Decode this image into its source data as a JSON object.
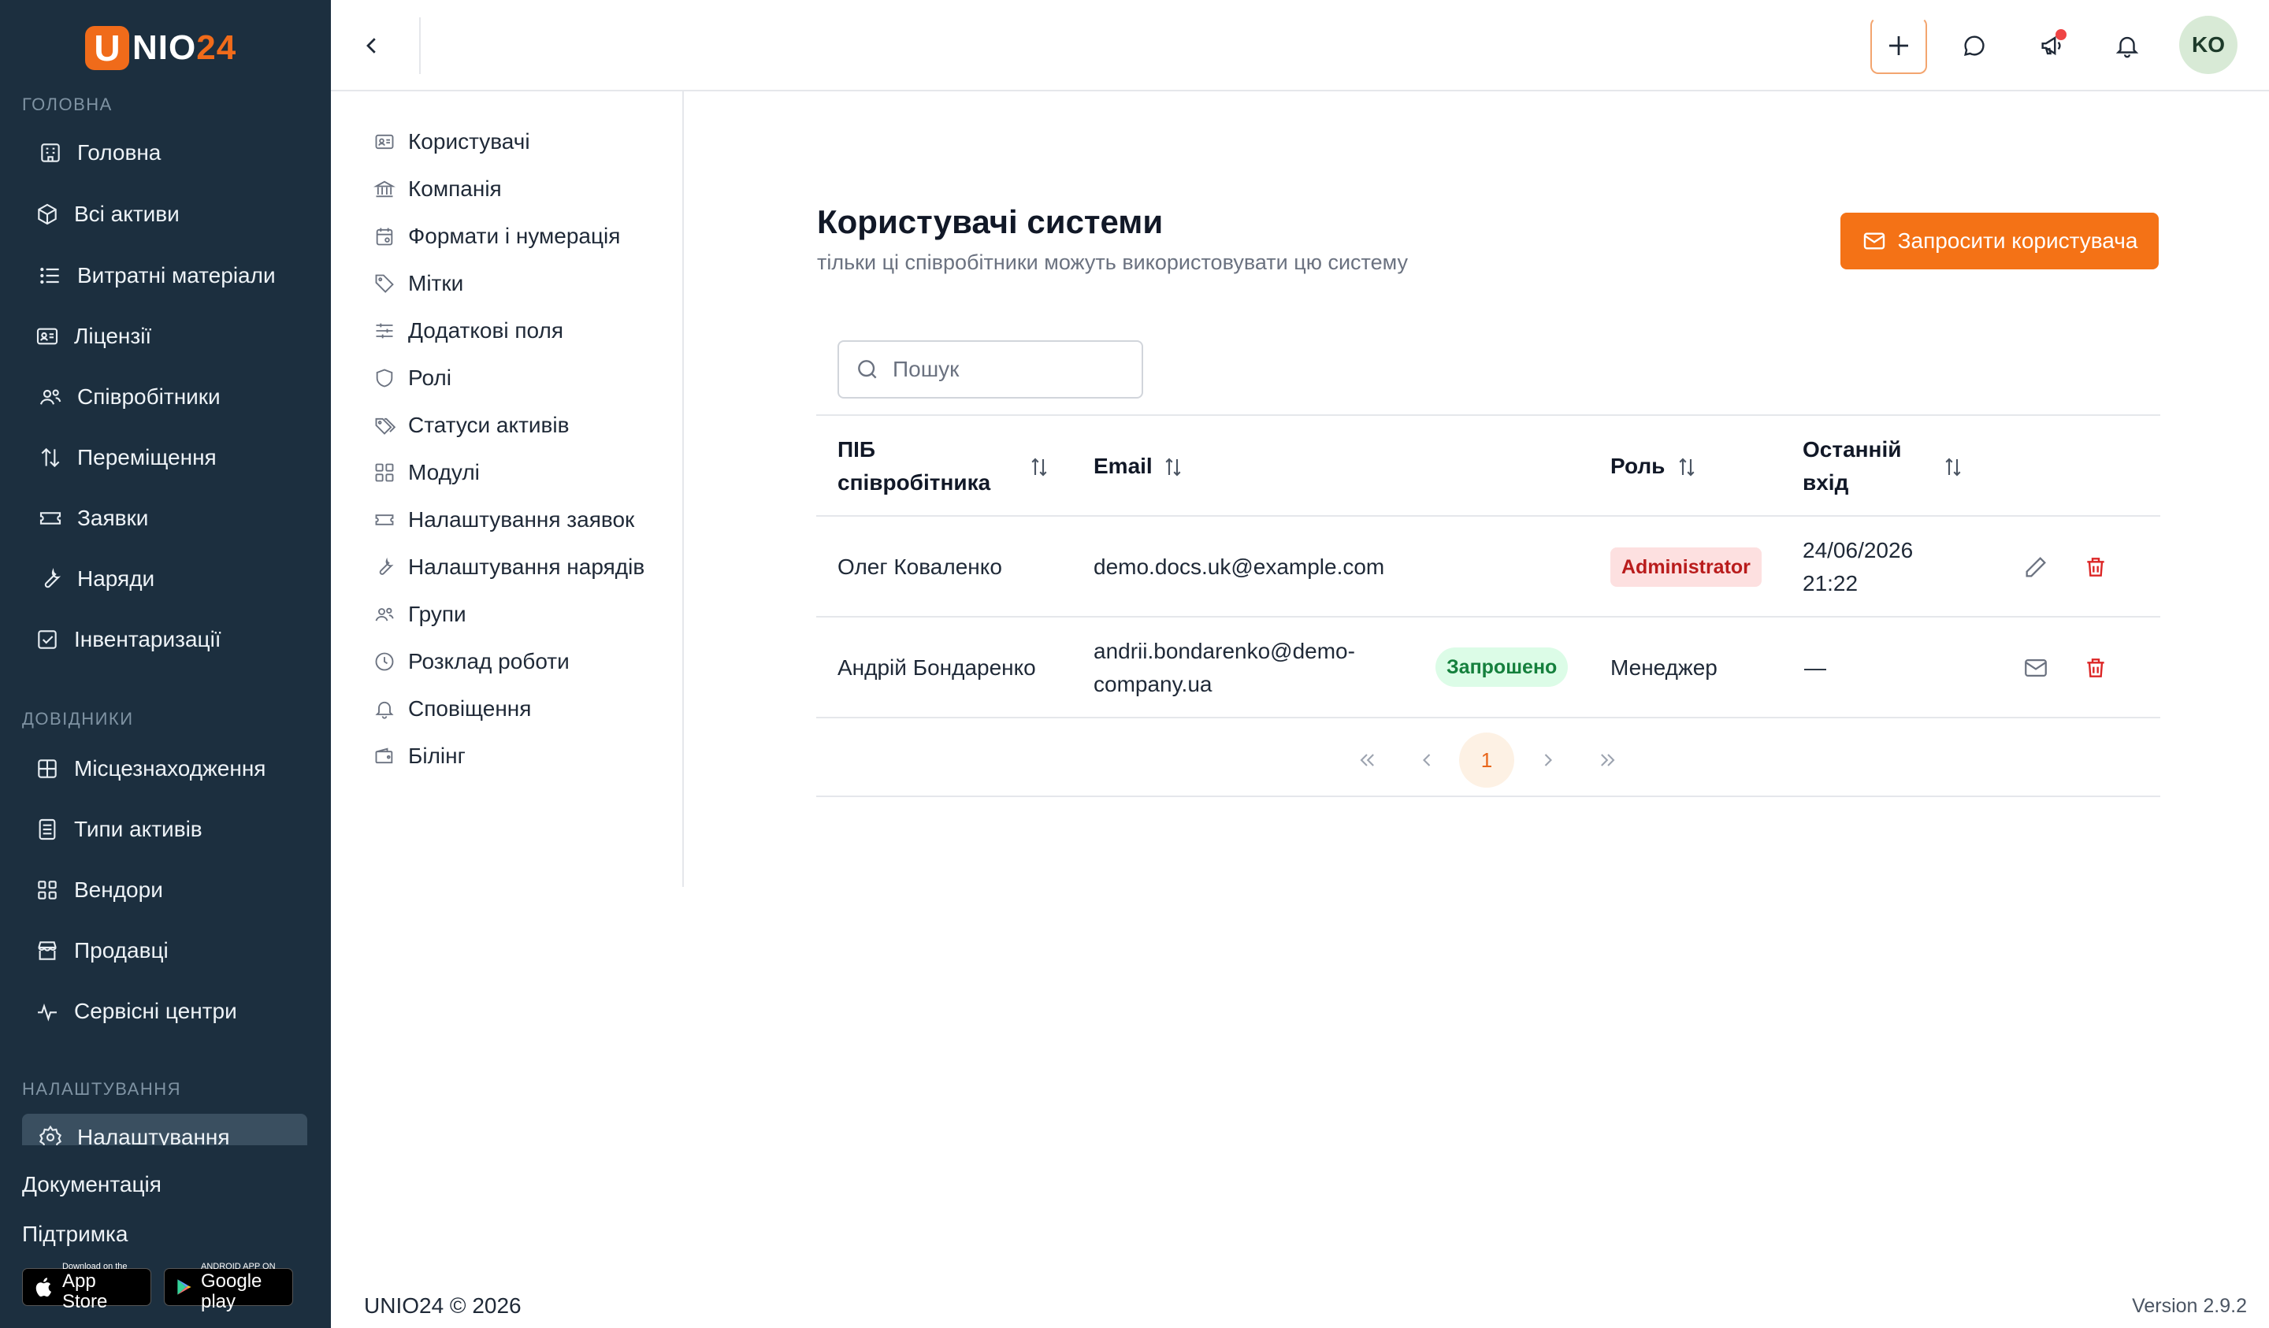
{
  "brand": {
    "logo_letter": "U",
    "logo_main": "NIO",
    "logo_accent": "24",
    "accent_color": "#f06b1a"
  },
  "sidebar": {
    "section_main": "ГОЛОВНА",
    "section_refs": "ДОВІДНИКИ",
    "section_settings": "НАЛАШТУВАННЯ",
    "items": [
      {
        "label": "Головна",
        "icon": "building-icon"
      },
      {
        "label": "Всі активи",
        "icon": "cube-icon"
      },
      {
        "label": "Витратні матеріали",
        "icon": "list-icon"
      },
      {
        "label": "Ліцензії",
        "icon": "id-card-icon"
      },
      {
        "label": "Співробітники",
        "icon": "users-icon"
      },
      {
        "label": "Переміщення",
        "icon": "arrows-up-down-icon"
      },
      {
        "label": "Заявки",
        "icon": "ticket-icon"
      },
      {
        "label": "Наряди",
        "icon": "wrench-icon"
      },
      {
        "label": "Інвентаризації",
        "icon": "checkbox-icon"
      }
    ],
    "refs": [
      {
        "label": "Місцезнаходження",
        "icon": "grid-icon"
      },
      {
        "label": "Типи активів",
        "icon": "document-icon"
      },
      {
        "label": "Вендори",
        "icon": "blocks-icon"
      },
      {
        "label": "Продавці",
        "icon": "store-icon"
      },
      {
        "label": "Сервісні центри",
        "icon": "activity-icon"
      }
    ],
    "settings_item": {
      "label": "Налаштування",
      "icon": "gear-icon"
    },
    "docs": "Документація",
    "support": "Підтримка",
    "appstore_small": "Download on the",
    "appstore_big": "App Store",
    "googleplay_small": "ANDROID APP ON",
    "googleplay_big": "Google play"
  },
  "settings_menu": [
    {
      "label": "Користувачі",
      "icon": "id-card-icon"
    },
    {
      "label": "Компанія",
      "icon": "bank-icon"
    },
    {
      "label": "Формати і нумерація",
      "icon": "calendar-icon"
    },
    {
      "label": "Мітки",
      "icon": "tag-icon"
    },
    {
      "label": "Додаткові поля",
      "icon": "sliders-icon"
    },
    {
      "label": "Ролі",
      "icon": "shield-icon"
    },
    {
      "label": "Статуси активів",
      "icon": "tags-icon"
    },
    {
      "label": "Модулі",
      "icon": "modules-icon"
    },
    {
      "label": "Налаштування заявок",
      "icon": "ticket-icon"
    },
    {
      "label": "Налаштування нарядів",
      "icon": "wrench-icon"
    },
    {
      "label": "Групи",
      "icon": "users-icon"
    },
    {
      "label": "Розклад роботи",
      "icon": "clock-icon"
    },
    {
      "label": "Сповіщення",
      "icon": "bell-icon"
    },
    {
      "label": "Білінг",
      "icon": "wallet-icon"
    }
  ],
  "topbar": {
    "avatar_initials": "KO"
  },
  "main": {
    "title": "Користувачі системи",
    "subtitle": "тільки ці співробітники можуть використовувати цю систему",
    "invite_label": "Запросити користувача",
    "search_placeholder": "Пошук",
    "columns": {
      "name_line1": "ПІБ",
      "name_line2": "співробітника",
      "email": "Email",
      "role": "Роль",
      "last_line1": "Останній",
      "last_line2": "вхід"
    },
    "rows": [
      {
        "name": "Олег Коваленко",
        "email_line1": "demo.docs.uk@example.com",
        "email_line2": "",
        "status": "",
        "role": "Administrator",
        "last_line1": "24/06/2026",
        "last_line2": "21:22"
      },
      {
        "name": "Андрій Бондаренко",
        "email_line1": "andrii.bondarenko@demo-",
        "email_line2": "company.ua",
        "status": "Запрошено",
        "role": "Менеджер",
        "last_line1": "—",
        "last_line2": ""
      }
    ],
    "pagination": {
      "current": "1"
    }
  },
  "footer": {
    "copyright": "UNIO24 © 2026",
    "version": "Version 2.9.2"
  }
}
